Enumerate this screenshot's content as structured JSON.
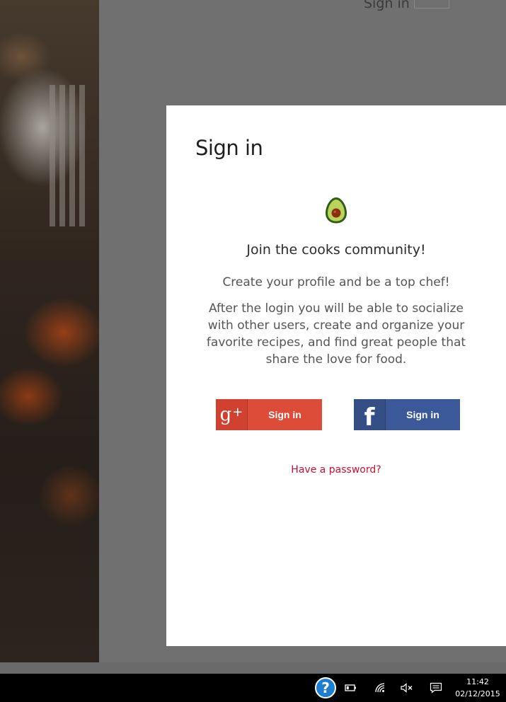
{
  "background": {
    "header_signin": "Sign in"
  },
  "dialog": {
    "title": "Sign in",
    "headline": "Join the cooks community!",
    "tagline": "Create your profile and be a top chef!",
    "description": "After the login you will be able to socialize with other users, create and organize your favorite recipes, and find great people that share the love for food.",
    "google_button": {
      "icon_text": "g",
      "icon_plus": "+",
      "label": "Sign in"
    },
    "facebook_button": {
      "icon_text": "f",
      "label": "Sign in"
    },
    "password_link": "Have a password?"
  },
  "taskbar": {
    "help_glyph": "?",
    "time": "11:42",
    "date": "02/12/2015"
  },
  "colors": {
    "google": "#dd4b39",
    "facebook": "#3b5998",
    "link": "#c8102e",
    "help": "#1e7fd1"
  }
}
